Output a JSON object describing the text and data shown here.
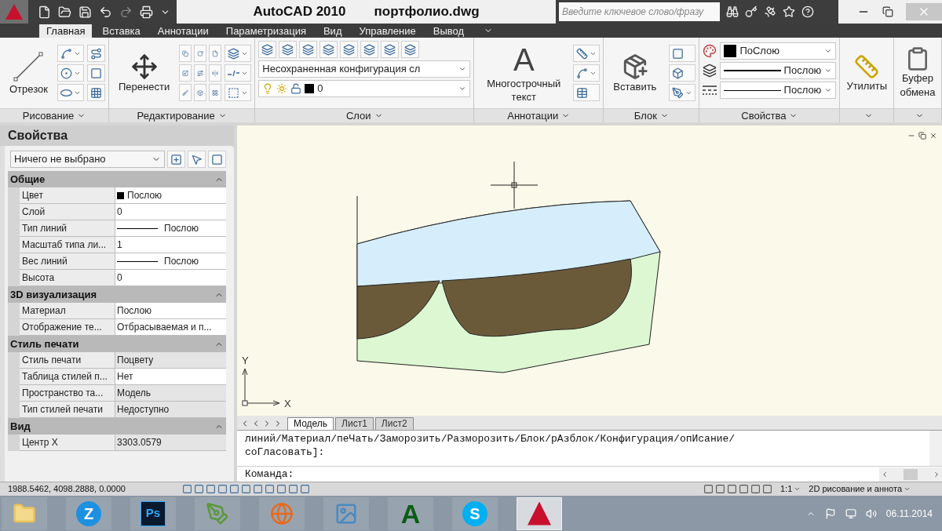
{
  "window": {
    "title": "AutoCAD 2010",
    "file": "портфолио.dwg"
  },
  "search": {
    "placeholder": "Введите ключевое слово/фразу"
  },
  "tabs": [
    {
      "label": "Главная",
      "selected": true
    },
    {
      "label": "Вставка",
      "selected": false
    },
    {
      "label": "Аннотации",
      "selected": false
    },
    {
      "label": "Параметризация",
      "selected": false
    },
    {
      "label": "Вид",
      "selected": false
    },
    {
      "label": "Управление",
      "selected": false
    },
    {
      "label": "Вывод",
      "selected": false
    }
  ],
  "ribbon": [
    {
      "kind": "draw",
      "label": "Рисование",
      "big_label": "Отрезок"
    },
    {
      "kind": "modify",
      "label": "Редактирование",
      "big_label": "Перенести"
    },
    {
      "kind": "layers",
      "label": "Слои",
      "config": "Несохраненная конфигурация сл",
      "layer": "0"
    },
    {
      "kind": "annotation",
      "label": "Аннотации",
      "glyph": "A",
      "big_label": "Многострочный текст"
    },
    {
      "kind": "block",
      "label": "Блок",
      "big_label": "Вставить"
    },
    {
      "kind": "properties",
      "label": "Свойства",
      "color_label": "ПоСлою",
      "lineweight": "Послою",
      "linetype": "Послою"
    },
    {
      "kind": "utilities",
      "big_label": "Утилиты"
    },
    {
      "kind": "clipboard",
      "big_label": "Буфер обмена"
    }
  ],
  "properties": {
    "title": "Свойства",
    "selection": "Ничего не выбрано",
    "sections": [
      {
        "title": "Общие",
        "expanded": true,
        "rows": [
          {
            "kind": "color",
            "name": "Цвет",
            "value": "Послою",
            "disabled": false
          },
          {
            "kind": "text",
            "name": "Слой",
            "value": "0",
            "disabled": false
          },
          {
            "kind": "line",
            "name": "Тип линий",
            "value": "Послою",
            "disabled": false
          },
          {
            "kind": "text",
            "name": "Масштаб типа ли...",
            "value": "1",
            "disabled": false
          },
          {
            "kind": "line",
            "name": "Вес линий",
            "value": "Послою",
            "disabled": false
          },
          {
            "kind": "text",
            "name": "Высота",
            "value": "0",
            "disabled": false
          }
        ]
      },
      {
        "title": "3D визуализация",
        "expanded": true,
        "rows": [
          {
            "kind": "text",
            "name": "Материал",
            "value": "Послою",
            "disabled": false
          },
          {
            "kind": "text",
            "name": "Отображение те...",
            "value": "Отбрасываемая и п...",
            "disabled": false
          }
        ]
      },
      {
        "title": "Стиль печати",
        "expanded": true,
        "rows": [
          {
            "kind": "text",
            "name": "Стиль печати",
            "value": "Поцвету",
            "disabled": true
          },
          {
            "kind": "text",
            "name": "Таблица стилей п...",
            "value": "Нет",
            "disabled": false
          },
          {
            "kind": "text",
            "name": "Пространство та...",
            "value": "Модель",
            "disabled": true
          },
          {
            "kind": "text",
            "name": "Тип стилей печати",
            "value": "Недоступно",
            "disabled": true
          }
        ]
      },
      {
        "title": "Вид",
        "expanded": true,
        "rows": [
          {
            "kind": "text",
            "name": "Центр X",
            "value": "3303.0579",
            "disabled": true
          }
        ]
      }
    ]
  },
  "axes": {
    "x": "X",
    "y": "Y"
  },
  "layout_tabs": [
    {
      "label": "Модель",
      "selected": true
    },
    {
      "label": "Лист1",
      "selected": false
    },
    {
      "label": "Лист2",
      "selected": false
    }
  ],
  "command": {
    "history": [
      "линий/Материал/пеЧать/Заморозить/Разморозить/Блок/рАзблок/Конфигурация/опИсание/",
      "соГласовать]:"
    ],
    "prompt": "Команда:"
  },
  "status_bar": {
    "coords": "1988.5462, 4098.2888, 0.0000",
    "scale": "1:1",
    "workspace": "2D рисование и аннота"
  },
  "taskbar": {
    "apps": [
      {
        "kind": "folder",
        "selected": false
      },
      {
        "kind": "circle",
        "glyph": "Z",
        "selected": false
      },
      {
        "kind": "square",
        "glyph": "Ps",
        "selected": false
      },
      {
        "kind": "pen",
        "selected": false
      },
      {
        "kind": "browser",
        "selected": false
      },
      {
        "kind": "picture",
        "selected": false
      },
      {
        "kind": "letter",
        "glyph": "A",
        "selected": false
      },
      {
        "kind": "circle_blue",
        "glyph": "S",
        "selected": false
      },
      {
        "kind": "autocad",
        "selected": true
      }
    ],
    "date": "06.11.2014"
  }
}
